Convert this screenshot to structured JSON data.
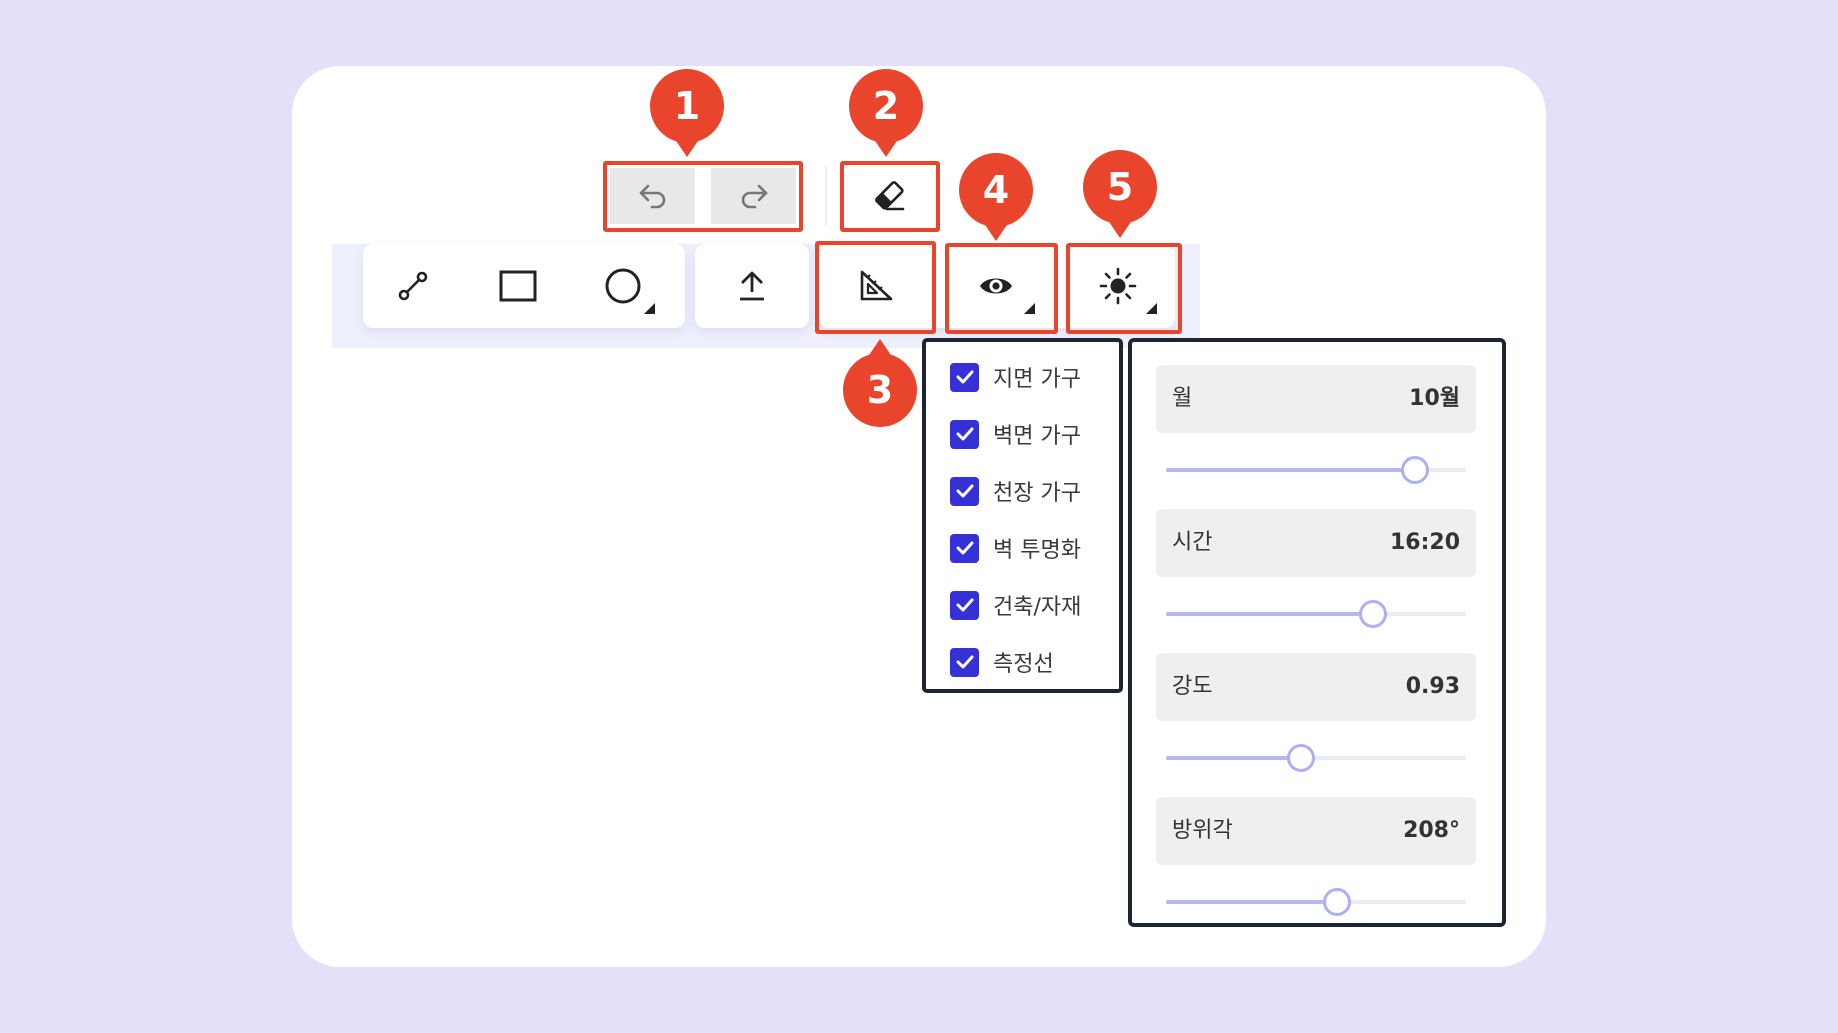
{
  "colors": {
    "page_background": "#e3e0f9",
    "card": "#ffffff",
    "annotation": "#e8452c",
    "checkbox": "#3531d6",
    "slider_accent": "#acb0f2",
    "panel_border": "#1d2533"
  },
  "markers": [
    "1",
    "2",
    "3",
    "4",
    "5"
  ],
  "toolbar": {
    "history": [
      {
        "icon": "undo-icon"
      },
      {
        "icon": "redo-icon"
      }
    ],
    "eraser": {
      "icon": "eraser-icon"
    },
    "draw_tools": [
      {
        "icon": "line-tool-icon"
      },
      {
        "icon": "rectangle-tool-icon"
      },
      {
        "icon": "circle-tool-icon",
        "has_submenu": true
      }
    ],
    "upload": {
      "icon": "upload-icon"
    },
    "measure": {
      "icon": "set-square-ruler-icon"
    },
    "visibility": {
      "icon": "eye-icon",
      "has_submenu": true
    },
    "lighting": {
      "icon": "sun-icon",
      "has_submenu": true
    }
  },
  "visibility_panel": {
    "items": [
      {
        "label": "지면 가구",
        "checked": true
      },
      {
        "label": "벽면 가구",
        "checked": true
      },
      {
        "label": "천장 가구",
        "checked": true
      },
      {
        "label": "벽 투명화",
        "checked": true
      },
      {
        "label": "건축/자재",
        "checked": true
      },
      {
        "label": "측정선",
        "checked": true
      }
    ]
  },
  "light_panel": {
    "items": [
      {
        "label": "월",
        "value": "10월",
        "fraction": 0.83
      },
      {
        "label": "시간",
        "value": "16:20",
        "fraction": 0.69
      },
      {
        "label": "강도",
        "value": "0.93",
        "fraction": 0.45
      },
      {
        "label": "방위각",
        "value": "208°",
        "fraction": 0.57
      }
    ]
  }
}
